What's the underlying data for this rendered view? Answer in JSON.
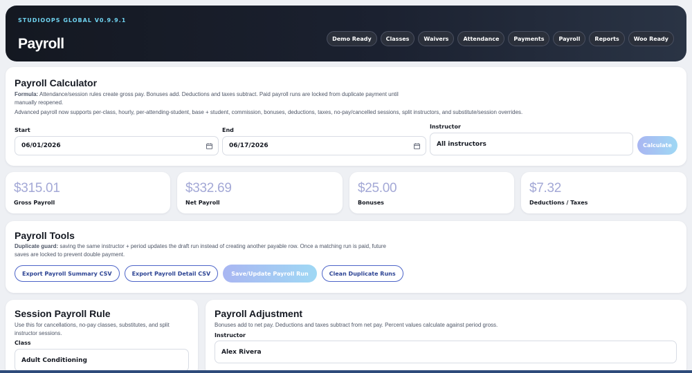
{
  "header": {
    "brand": "STUDIOOPS GLOBAL V0.9.9.1",
    "title": "Payroll",
    "nav": [
      "Demo Ready",
      "Classes",
      "Waivers",
      "Attendance",
      "Payments",
      "Payroll",
      "Reports",
      "Woo Ready"
    ]
  },
  "calculator": {
    "title": "Payroll Calculator",
    "formula_lead": "Formula:",
    "formula_text": "Attendance/session rules create gross pay. Bonuses add. Deductions and taxes subtract. Paid payroll runs are locked from duplicate payment until manually reopened.",
    "advanced_text": "Advanced payroll now supports per-class, hourly, per-attending-student, base + student, commission, bonuses, deductions, taxes, no-pay/cancelled sessions, split instructors, and substitute/session overrides.",
    "start_label": "Start",
    "start_value": "06/01/2026",
    "end_label": "End",
    "end_value": "06/17/2026",
    "instructor_label": "Instructor",
    "instructor_value": "All instructors",
    "calculate_label": "Calculate"
  },
  "stats": [
    {
      "value": "$315.01",
      "label": "Gross Payroll"
    },
    {
      "value": "$332.69",
      "label": "Net Payroll"
    },
    {
      "value": "$25.00",
      "label": "Bonuses"
    },
    {
      "value": "$7.32",
      "label": "Deductions / Taxes"
    }
  ],
  "tools": {
    "title": "Payroll Tools",
    "guard_lead": "Duplicate guard:",
    "guard_text": "saving the same instructor + period updates the draft run instead of creating another payable row. Once a matching run is paid, future saves are locked to prevent double payment.",
    "buttons": {
      "export_summary": "Export Payroll Summary CSV",
      "export_detail": "Export Payroll Detail CSV",
      "save_update": "Save/Update Payroll Run",
      "clean_duplicates": "Clean Duplicate Runs"
    }
  },
  "session_rule": {
    "title": "Session Payroll Rule",
    "desc": "Use this for cancellations, no-pay classes, substitutes, and split instructor sessions.",
    "class_label": "Class",
    "class_value": "Adult Conditioning"
  },
  "adjustment": {
    "title": "Payroll Adjustment",
    "desc": "Bonuses add to net pay. Deductions and taxes subtract from net pay. Percent values calculate against period gross.",
    "instructor_label": "Instructor",
    "instructor_value": "Alex Rivera"
  },
  "colors": {
    "accent": "#4b63c8",
    "stat_value": "#a3a8d6",
    "brand_cyan": "#6fd3f0"
  }
}
